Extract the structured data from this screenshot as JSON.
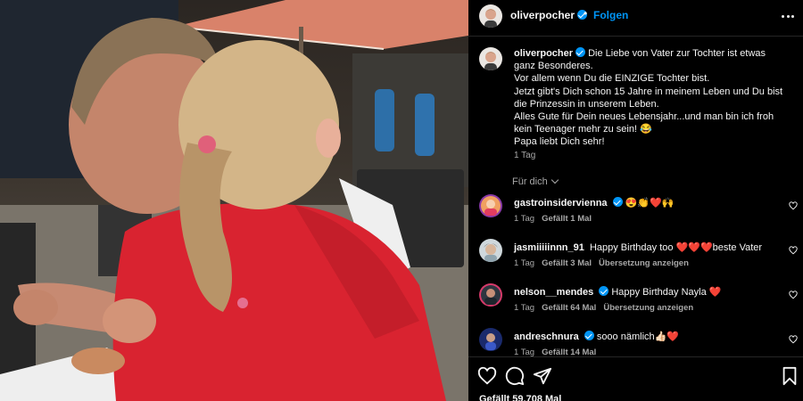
{
  "post": {
    "photo_alt": "",
    "username": "oliverpocher",
    "follow_label": "Folgen",
    "separator": "•",
    "more_icon": "more-horizontal-icon",
    "verified_color": "#0095f6"
  },
  "caption": {
    "username": "oliverpocher",
    "lines": [
      "Die Liebe von Vater zur Tochter ist etwas",
      "ganz Besonderes.",
      "Vor allem wenn Du die EINZIGE Tochter bist.",
      "Jetzt gibt's Dich schon 15 Jahre in meinem Leben und Du bist",
      "die Prinzessin in unserem Leben.",
      "Alles Gute für Dein neues Lebensjahr...und man bin ich froh",
      "kein Teenager mehr zu sein! 😂",
      "Papa liebt Dich sehr!"
    ],
    "time": "1 Tag"
  },
  "filter": {
    "label": "Für dich"
  },
  "comments": [
    {
      "username": "gastroinsidervienna",
      "verified": true,
      "text": "😍👏❤️🙌",
      "time": "1 Tag",
      "likes": "Gefällt 1 Mal",
      "translate": ""
    },
    {
      "username": "jasmiiiiinnn_91",
      "verified": false,
      "text": "Happy Birthday too ❤️❤️❤️beste Vater",
      "time": "1 Tag",
      "likes": "Gefällt 3 Mal",
      "translate": "Übersetzung anzeigen"
    },
    {
      "username": "nelson__mendes",
      "verified": true,
      "text": "Happy Birthday Nayla ❤️",
      "time": "1 Tag",
      "likes": "Gefällt 64 Mal",
      "translate": "Übersetzung anzeigen"
    },
    {
      "username": "andreschnura",
      "verified": true,
      "text": "sooo nämlich👍🏻❤️",
      "time": "1 Tag",
      "likes": "Gefällt 14 Mal",
      "translate": ""
    }
  ],
  "actions": {
    "like_icon": "heart-icon",
    "comment_icon": "comment-icon",
    "share_icon": "share-icon",
    "save_icon": "bookmark-icon",
    "likes_count": "Gefällt 59.708 Mal"
  }
}
